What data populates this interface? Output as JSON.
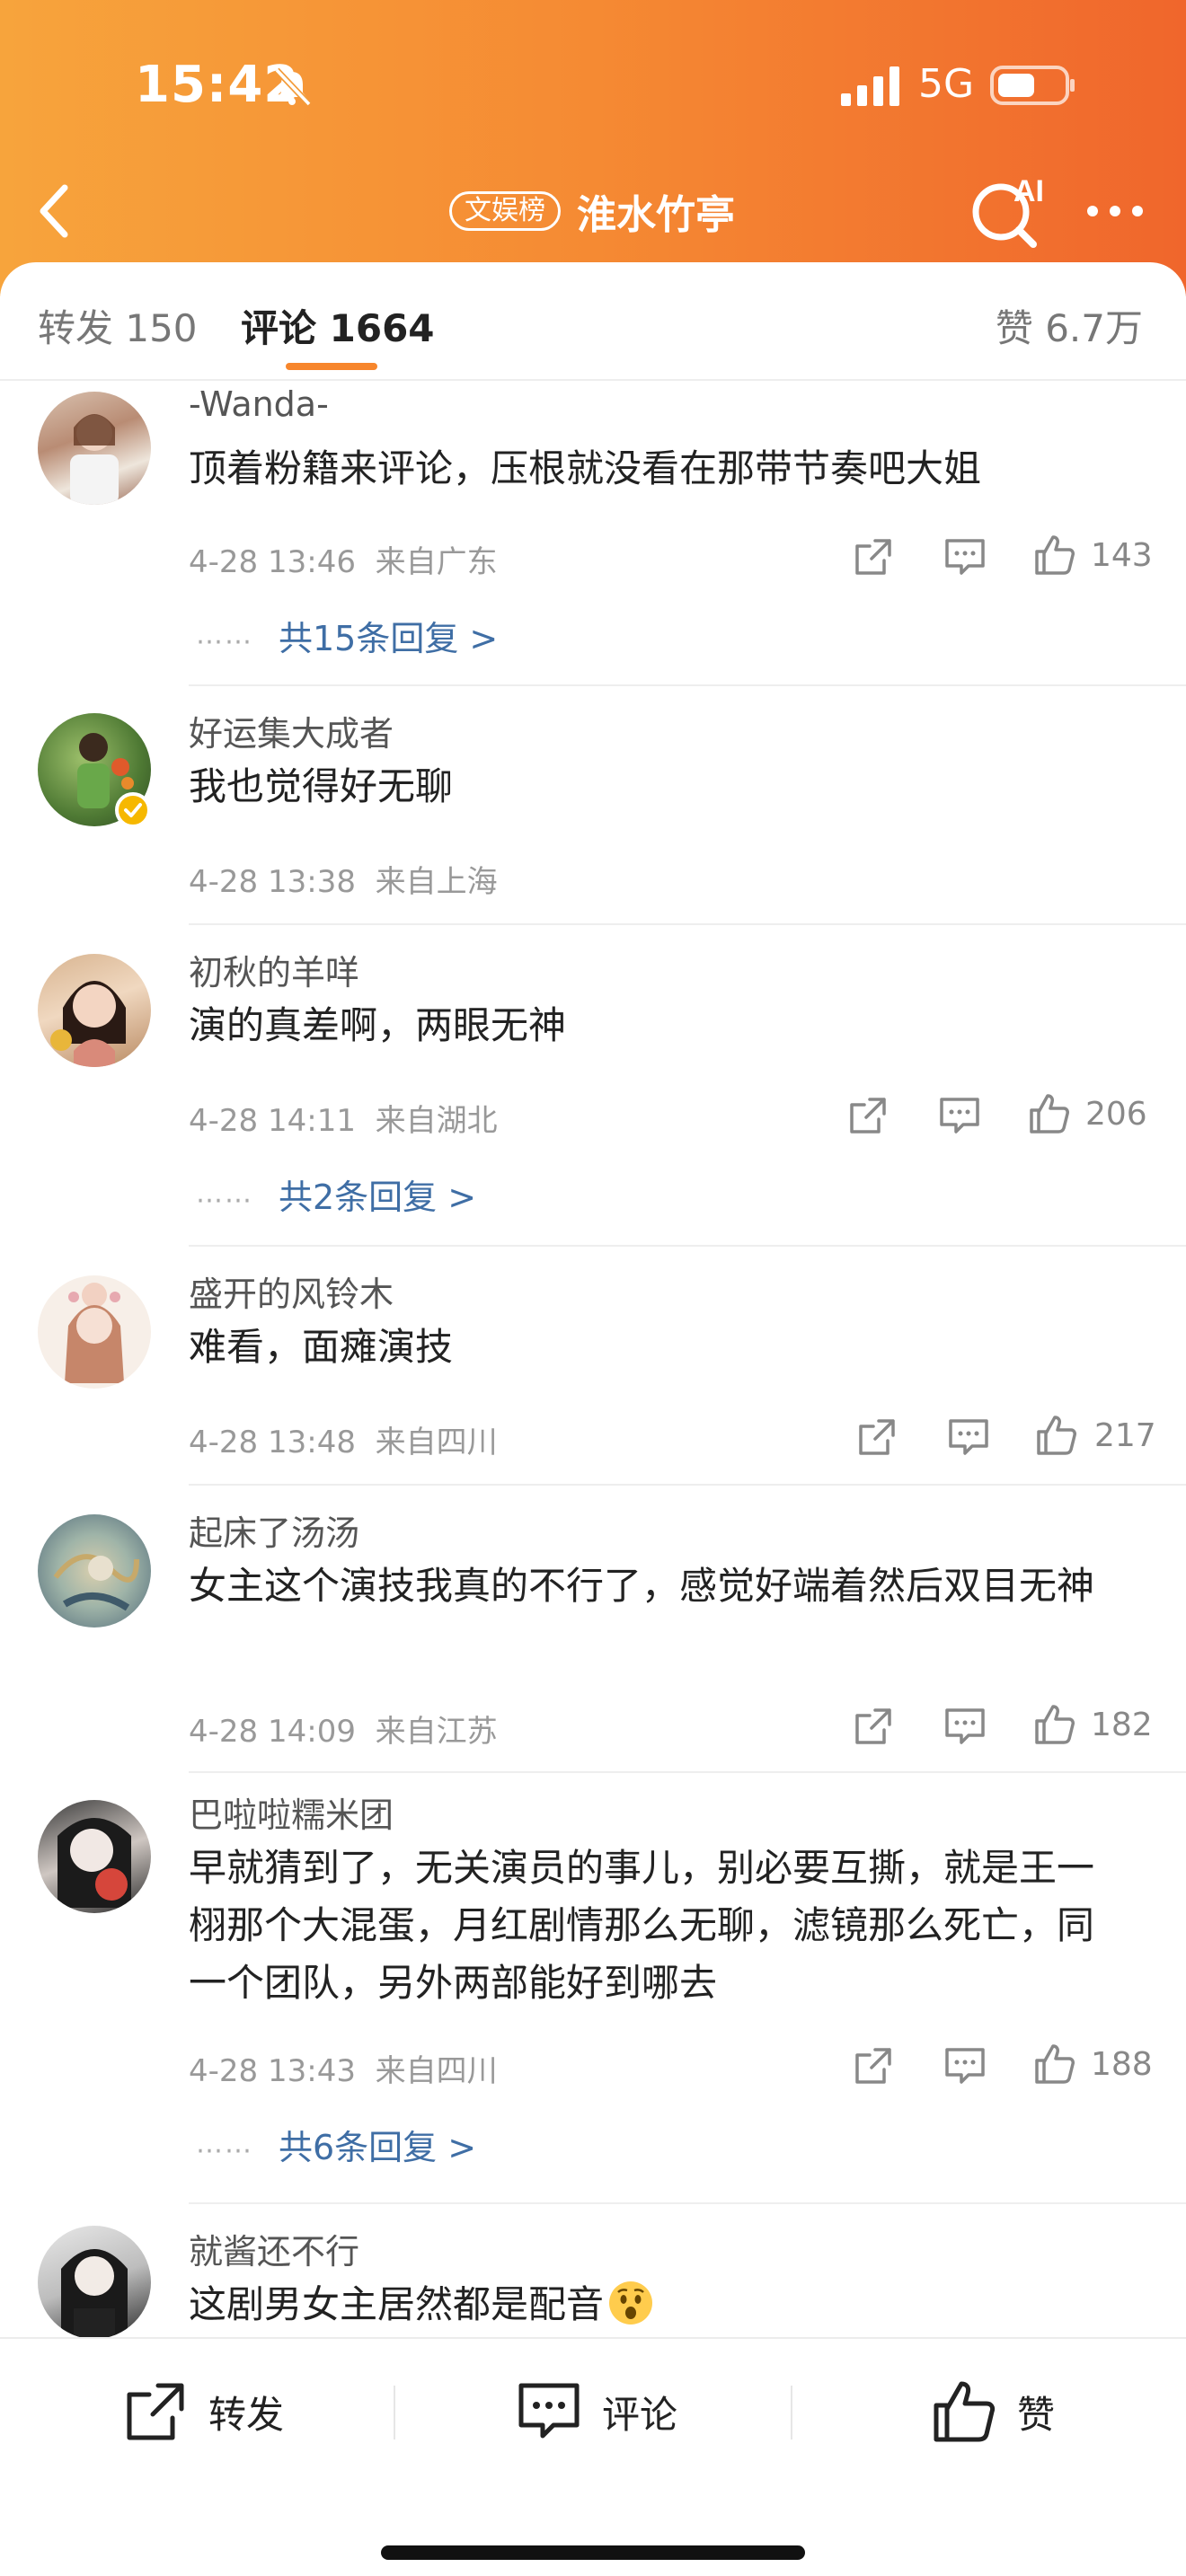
{
  "status_bar": {
    "time": "15:42",
    "network": "5G",
    "icons": [
      "bell-muted-icon",
      "signal-icon",
      "battery-icon"
    ]
  },
  "nav": {
    "badge": "文娱榜",
    "title": "淮水竹亭",
    "icons": [
      "back-icon",
      "ai-search-icon",
      "more-icon"
    ]
  },
  "tabs": {
    "repost": "转发 150",
    "comments": "评论 1664",
    "likes": "赞 6.7万",
    "active": "comments"
  },
  "comments": [
    {
      "username": "-Wanda-",
      "content": "顶着粉籍来评论，压根就没看在那带节奏吧大姐",
      "time": "4-28 13:46",
      "location": "来自广东",
      "likes": "143",
      "replies": "共15条回复 >",
      "replies_dots": "⋯⋯",
      "verified": false
    },
    {
      "username": "好运集大成者",
      "content": "我也觉得好无聊",
      "time": "4-28 13:38",
      "location": "来自上海",
      "likes": "",
      "replies": "",
      "verified": true
    },
    {
      "username": "初秋的羊咩",
      "content": "演的真差啊，两眼无神",
      "time": "4-28 14:11",
      "location": "来自湖北",
      "likes": "206",
      "replies": "共2条回复 >",
      "replies_dots": "⋯⋯",
      "verified": false
    },
    {
      "username": "盛开的风铃木",
      "content": "难看，面瘫演技",
      "time": "4-28 13:48",
      "location": "来自四川",
      "likes": "217",
      "replies": "",
      "verified": false
    },
    {
      "username": "起床了汤汤",
      "content": "女主这个演技我真的不行了，感觉好端着然后双目无神",
      "time": "4-28 14:09",
      "location": "来自江苏",
      "likes": "182",
      "replies": "",
      "verified": false
    },
    {
      "username": "巴啦啦糯米团",
      "content": "早就猜到了，无关演员的事儿，别必要互撕，就是王一栩那个大混蛋，月红剧情那么无聊，滤镜那么死亡，同一个团队，另外两部能好到哪去",
      "time": "4-28 13:43",
      "location": "来自四川",
      "likes": "188",
      "replies": "共6条回复 >",
      "replies_dots": "⋯⋯",
      "verified": false
    },
    {
      "username": "就酱还不行",
      "content": "这剧男女主居然都是配音",
      "emoji": "surprised-face-icon",
      "verified": false
    }
  ],
  "bottom_bar": {
    "repost": "转发",
    "comment": "评论",
    "like": "赞"
  },
  "colors": {
    "header_start": "#f7a43c",
    "header_end": "#f0662c",
    "accent": "#f7862c",
    "link": "#3f6ea5",
    "verified": "#f6b800"
  }
}
